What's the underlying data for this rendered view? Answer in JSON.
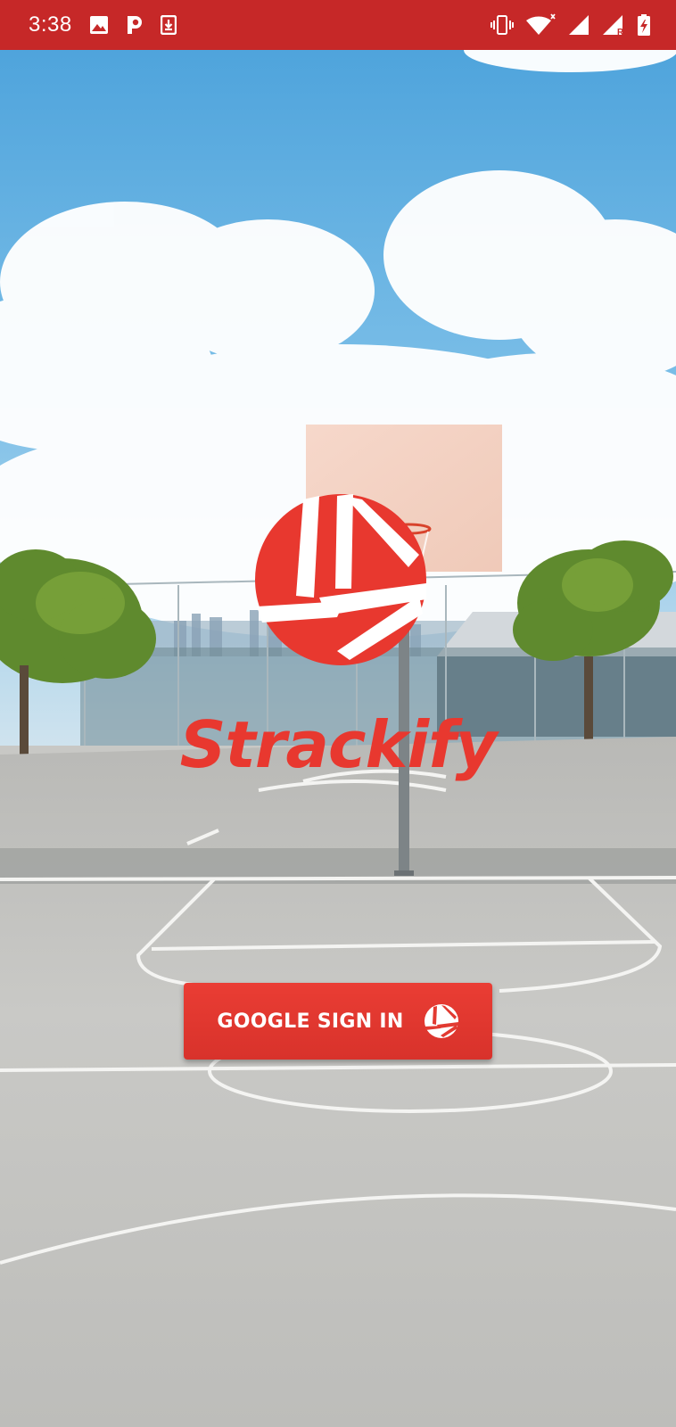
{
  "status_bar": {
    "time": "3:38",
    "left_icons": [
      "image-icon",
      "parking-icon",
      "download-icon"
    ],
    "right_icons": [
      "vibrate-icon",
      "wifi-icon",
      "signal-icon",
      "signal-roaming-icon",
      "battery-charging-icon"
    ]
  },
  "app": {
    "name": "Strackify",
    "brand_color": "#e8382f",
    "logo_icon": "strackify-logo-icon"
  },
  "signin": {
    "label": "GOOGLE SIGN IN",
    "icon": "strackify-logo-icon"
  },
  "colors": {
    "status_bar": "#c62828",
    "button": "#e23a31"
  }
}
